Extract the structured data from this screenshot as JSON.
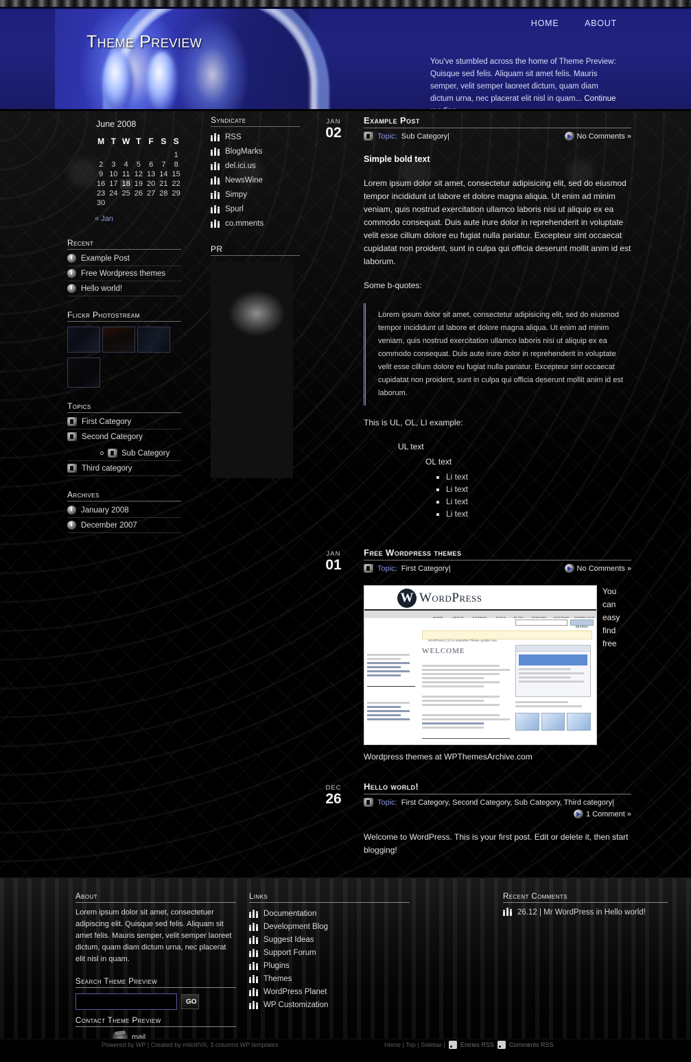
{
  "header": {
    "site_title": "Theme Preview",
    "nav": [
      {
        "label": "HOME"
      },
      {
        "label": "ABOUT"
      }
    ],
    "description": "You've stumbled across the home of Theme Preview: Quisque sed felis. Aliquam sit amet felis. Mauris semper, velit semper laoreet dictum, quam diam dictum urna, nec placerat elit nisl in quam...",
    "continue_link": "Continue reading →"
  },
  "calendar": {
    "title": "June 2008",
    "weekdays": [
      "M",
      "T",
      "W",
      "T",
      "F",
      "S",
      "S"
    ],
    "weeks": [
      [
        "",
        "",
        "",
        "",
        "",
        "",
        "1"
      ],
      [
        "2",
        "3",
        "4",
        "5",
        "6",
        "7",
        "8"
      ],
      [
        "9",
        "10",
        "11",
        "12",
        "13",
        "14",
        "15"
      ],
      [
        "16",
        "17",
        "18",
        "19",
        "20",
        "21",
        "22"
      ],
      [
        "23",
        "24",
        "25",
        "26",
        "27",
        "28",
        "29"
      ],
      [
        "30",
        "",
        "",
        "",
        "",
        "",
        ""
      ]
    ],
    "today": "18",
    "prev_link": "« Jan"
  },
  "recent": {
    "title": "Recent",
    "items": [
      {
        "label": "Example Post",
        "icon": "power-icon"
      },
      {
        "label": "Free Wordpress themes",
        "icon": "power-icon"
      },
      {
        "label": "Hello world!",
        "icon": "power-icon"
      }
    ]
  },
  "flickr": {
    "title": "Flickr Photostream",
    "thumbs": [
      "thumb-1",
      "thumb-2",
      "thumb-3",
      "thumb-4"
    ]
  },
  "topics": {
    "title": "Topics",
    "items": [
      {
        "label": "First Category",
        "icon": "folder-icon"
      },
      {
        "label": "Second Category",
        "icon": "folder-icon"
      },
      {
        "label": "Sub Category",
        "icon": "folder-icon",
        "sub": true
      },
      {
        "label": "Third category",
        "icon": "folder-icon"
      }
    ]
  },
  "archives": {
    "title": "Archives",
    "items": [
      {
        "label": "January 2008",
        "icon": "power-icon"
      },
      {
        "label": "December 2007",
        "icon": "power-icon"
      }
    ]
  },
  "syndicate": {
    "title": "Syndicate",
    "items": [
      {
        "label": "RSS",
        "icon": "people-icon"
      },
      {
        "label": "BlogMarks",
        "icon": "people-icon"
      },
      {
        "label": "del.ici.us",
        "icon": "people-icon"
      },
      {
        "label": "NewsWine",
        "icon": "people-icon"
      },
      {
        "label": "Simpy",
        "icon": "people-icon"
      },
      {
        "label": "Spurl",
        "icon": "people-icon"
      },
      {
        "label": "co.mments",
        "icon": "people-icon"
      }
    ]
  },
  "pr": {
    "title": "PR"
  },
  "posts": [
    {
      "month": "JAN",
      "day": "02",
      "title": "Example Post",
      "topic_word": "Topic:",
      "categories": "Sub Category|",
      "comments": "No Comments »",
      "bold_lead": "Simple bold text",
      "paragraph1": "Lorem ipsum dolor sit amet, consectetur adipisicing elit, sed do eiusmod tempor incididunt ut labore et dolore magna aliqua. Ut enim ad minim veniam, quis nostrud exercitation ullamco laboris nisi ut aliquip ex ea commodo consequat. Duis aute irure dolor in reprehenderit in voluptate velit esse cillum dolore eu fugiat nulla pariatur. Excepteur sint occaecat cupidatat non proident, sunt in culpa qui officia deserunt mollit anim id est laborum.",
      "quote_intro": "Some b-quotes:",
      "blockquote": "Lorem ipsum dolor sit amet, consectetur adipisicing elit, sed do eiusmod tempor incididunt ut labore et dolore magna aliqua. Ut enim ad minim veniam, quis nostrud exercitation ullamco laboris nisi ut aliquip ex ea commodo consequat. Duis aute irure dolor in reprehenderit in voluptate velit esse cillum dolore eu fugiat nulla pariatur. Excepteur sint occaecat cupidatat non proident, sunt in culpa qui officia deserunt mollit anim id est laborum.",
      "list_intro": "This is UL, OL, LI example:",
      "ul_text": "UL text",
      "ol_text": "OL text",
      "li_items": [
        "Li text",
        "Li text",
        "Li text",
        "Li text"
      ]
    },
    {
      "month": "JAN",
      "day": "01",
      "title": "Free Wordpress themes",
      "topic_word": "Topic:",
      "categories": "First Category|",
      "comments": "No Comments »",
      "side_text": "You can easy find free",
      "caption": "Wordpress themes at WPThemesArchive.com",
      "screenshot": {
        "logo": "W",
        "brand": "WordPress",
        "nav": [
          "HOME",
          "ABOUT",
          "EXTEND",
          "DOCS",
          "BLOG",
          "FORUMS",
          "HOSTING",
          "DOWNLOAD"
        ],
        "search_button": "SEARCH",
        "notice": "WordPress 2.3.3 is available! Please update now.",
        "welcome": "WELCOME"
      }
    },
    {
      "month": "DEC",
      "day": "26",
      "title": "Hello world!",
      "topic_word": "Topic:",
      "categories": "First Category, Second Category, Sub Category, Third category|",
      "comments": "1 Comment »",
      "paragraph1": "Welcome to WordPress. This is your first post. Edit or delete it, then start blogging!"
    }
  ],
  "footer": {
    "about": {
      "title": "About",
      "text": "Lorem ipsum dolor sit amet, consectetuer adipiscing elit. Quisque sed felis. Aliquam sit amet felis. Mauris semper, velit semper laoreet dictum, quam diam dictum urna, nec placerat elit nisl in quam."
    },
    "search": {
      "label": "Search Theme Preview",
      "value": "",
      "placeholder": "",
      "button": "GO"
    },
    "contact": {
      "label": "Contact Theme Preview",
      "mail_link": "mail"
    },
    "links": {
      "title": "Links",
      "items": [
        {
          "label": "Documentation",
          "icon": "people-icon"
        },
        {
          "label": "Development Blog",
          "icon": "people-icon"
        },
        {
          "label": "Suggest Ideas",
          "icon": "people-icon"
        },
        {
          "label": "Support Forum",
          "icon": "people-icon"
        },
        {
          "label": "Plugins",
          "icon": "people-icon"
        },
        {
          "label": "Themes",
          "icon": "people-icon"
        },
        {
          "label": "WordPress Planet",
          "icon": "people-icon"
        },
        {
          "label": "WP Customization",
          "icon": "people-icon"
        }
      ]
    },
    "recent_comments": {
      "title": "Recent Comments",
      "items": [
        {
          "text": "26.12 | Mr WordPress in Hello world!",
          "icon": "people-icon"
        }
      ]
    }
  },
  "credits": {
    "left": "Powered by WP | Created by miloIIIVII, 3 columns WP templates",
    "nav": "Home | Top | Sidebar |",
    "entries_rss": "Entries RSS",
    "comments_rss": "Comments RSS"
  },
  "colors": {
    "header_blue": "#20237f",
    "link_purple": "#8a93e3",
    "background": "#000000",
    "text": "#e3e3e3"
  }
}
